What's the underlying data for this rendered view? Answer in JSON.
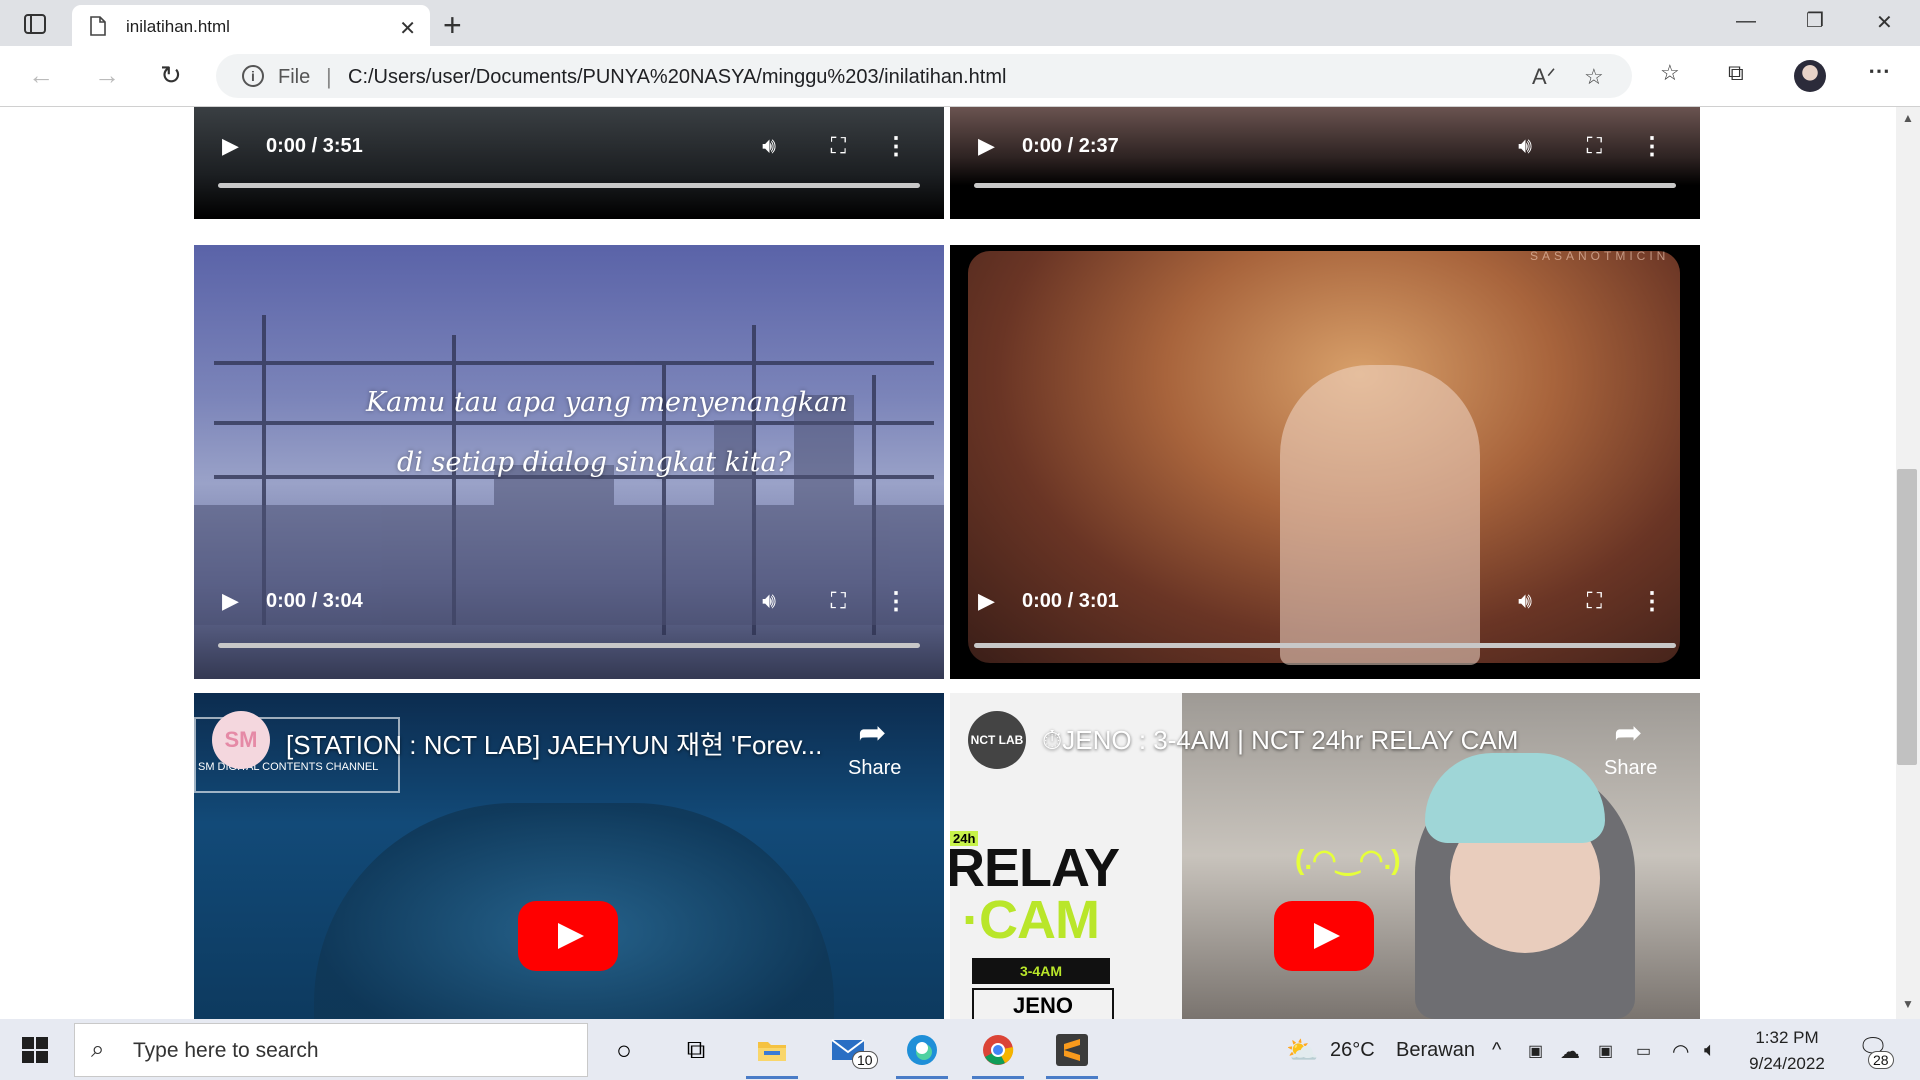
{
  "browser": {
    "tab_title": "inilatihan.html",
    "address_scheme": "File",
    "address_separator": "|",
    "url": "C:/Users/user/Documents/PUNYA%20NASYA/minggu%203/inilatihan.html"
  },
  "videos": [
    {
      "time": "0:00 / 3:51"
    },
    {
      "time": "0:00 / 2:37"
    },
    {
      "time": "0:00 / 3:04",
      "lyric_line1": "Kamu tau apa yang menyenangkan",
      "lyric_line2": "di setiap dialog singkat kita?"
    },
    {
      "time": "0:00 / 3:01",
      "watermark": "SASANOTMICIN"
    }
  ],
  "youtube": [
    {
      "title": "[STATION : NCT LAB] JAEHYUN 재현 'Forev...",
      "share_label": "Share",
      "channel_caption": "SM DIGITAL CONTENTS CHANNEL",
      "channel_mark": "SM"
    },
    {
      "title": "⏱JENO : 3-4AM | NCT 24hr RELAY CAM",
      "share_label": "Share",
      "channel_mark": "NCT LAB",
      "poster_line1": "RELAY",
      "poster_line2": "·CAM",
      "poster_time": "3-4AM",
      "poster_name": "JENO",
      "poster_tag": "24h",
      "emoticon": "(.◠‿◠.)"
    }
  ],
  "taskbar": {
    "search_placeholder": "Type here to search",
    "mail_badge": "10",
    "weather_temp": "26°C",
    "weather_desc": "Berawan",
    "time": "1:32 PM",
    "date": "9/24/2022",
    "notification_count": "28"
  },
  "colors": {
    "youtube_red": "#ff0000",
    "taskbar_bg": "#e7eaf2",
    "tab_bar": "#dfe1e5"
  },
  "icons": [
    "tab-actions-icon",
    "page-icon",
    "close-icon",
    "plus-icon",
    "minimize-icon",
    "maximize-icon",
    "window-close-icon",
    "back-icon",
    "forward-icon",
    "refresh-icon",
    "info-icon",
    "read-aloud-icon",
    "add-favorite-icon",
    "favorites-icon",
    "collections-icon",
    "more-icon",
    "play-icon",
    "volume-icon",
    "fullscreen-icon",
    "kebab-icon",
    "share-icon",
    "windows-start-icon",
    "search-icon",
    "cortana-icon",
    "task-view-icon",
    "file-explorer-icon",
    "mail-icon",
    "edge-icon",
    "chrome-icon",
    "sublime-icon",
    "weather-icon",
    "chevron-up-icon",
    "wifi-icon",
    "speaker-icon",
    "notification-icon"
  ]
}
